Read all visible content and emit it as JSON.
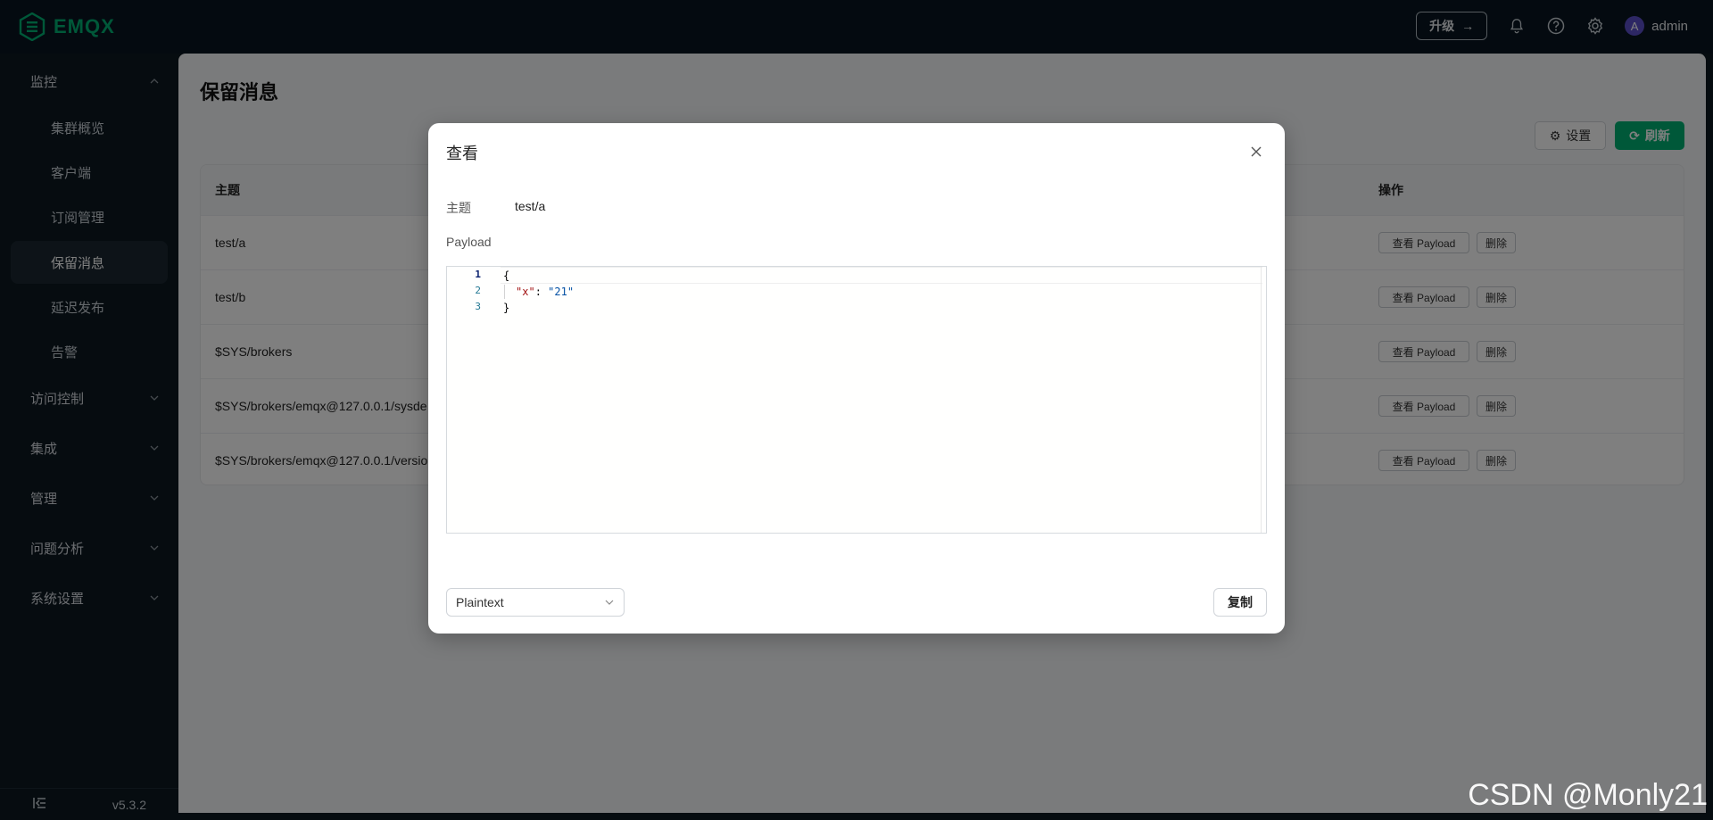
{
  "app": {
    "brand": "EMQX",
    "brand_color": "#00b173"
  },
  "header": {
    "upgrade_label": "升级",
    "user_initial": "A",
    "username": "admin",
    "icons": [
      "bell-icon",
      "help-icon",
      "gear-icon"
    ]
  },
  "sidebar": {
    "groups": [
      {
        "label": "监控",
        "expanded": true
      },
      {
        "label": "访问控制",
        "expanded": false
      },
      {
        "label": "集成",
        "expanded": false
      },
      {
        "label": "管理",
        "expanded": false
      },
      {
        "label": "问题分析",
        "expanded": false
      },
      {
        "label": "系统设置",
        "expanded": false
      }
    ],
    "items": [
      {
        "label": "集群概览"
      },
      {
        "label": "客户端"
      },
      {
        "label": "订阅管理"
      },
      {
        "label": "保留消息",
        "active": true
      },
      {
        "label": "延迟发布"
      },
      {
        "label": "告警"
      }
    ],
    "version": "v5.3.2"
  },
  "main": {
    "title": "保留消息",
    "settings_label": "设置",
    "refresh_label": "刷新",
    "table": {
      "columns": {
        "topic": "主题",
        "actions": "操作"
      },
      "rows": [
        {
          "topic": "test/a"
        },
        {
          "topic": "test/b"
        },
        {
          "topic": "$SYS/brokers"
        },
        {
          "topic": "$SYS/brokers/emqx@127.0.0.1/sysde"
        },
        {
          "topic": "$SYS/brokers/emqx@127.0.0.1/versio"
        }
      ],
      "view_payload_label": "查看 Payload",
      "delete_label": "删除"
    }
  },
  "dialog": {
    "title": "查看",
    "topic_label": "主题",
    "topic_value": "test/a",
    "payload_label": "Payload",
    "editor": {
      "line_numbers": [
        "1",
        "2",
        "3"
      ],
      "line1": "{",
      "line2_key": "\"x\"",
      "line2_sep": ": ",
      "line2_val": "\"21\"",
      "line3": "}"
    },
    "format_select_value": "Plaintext",
    "copy_label": "复制"
  },
  "watermark": "CSDN @Monly21"
}
